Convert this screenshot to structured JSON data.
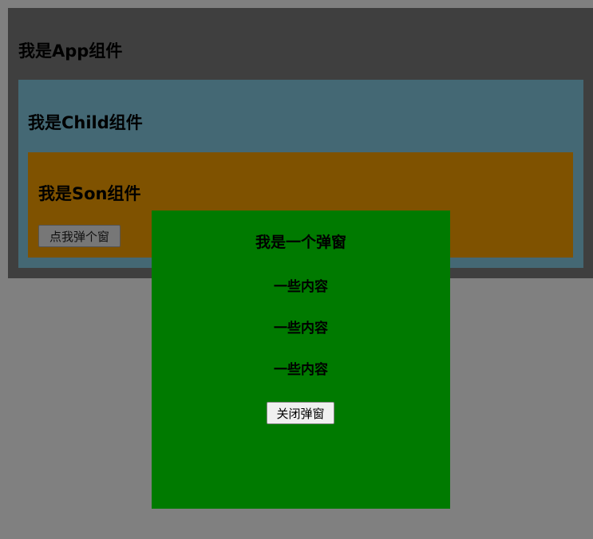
{
  "app": {
    "title": "我是App组件",
    "child": {
      "title": "我是Child组件",
      "son": {
        "title": "我是Son组件",
        "open_button_label": "点我弹个窗"
      }
    }
  },
  "modal": {
    "title": "我是一个弹窗",
    "lines": [
      "一些内容",
      "一些内容",
      "一些内容"
    ],
    "close_button_label": "关闭弹窗"
  },
  "colors": {
    "page_overlay": "#808080",
    "app_bg": "#3f3f3f",
    "child_bg": "#446874",
    "son_bg": "#7f5200",
    "modal_bg": "#007a00"
  }
}
